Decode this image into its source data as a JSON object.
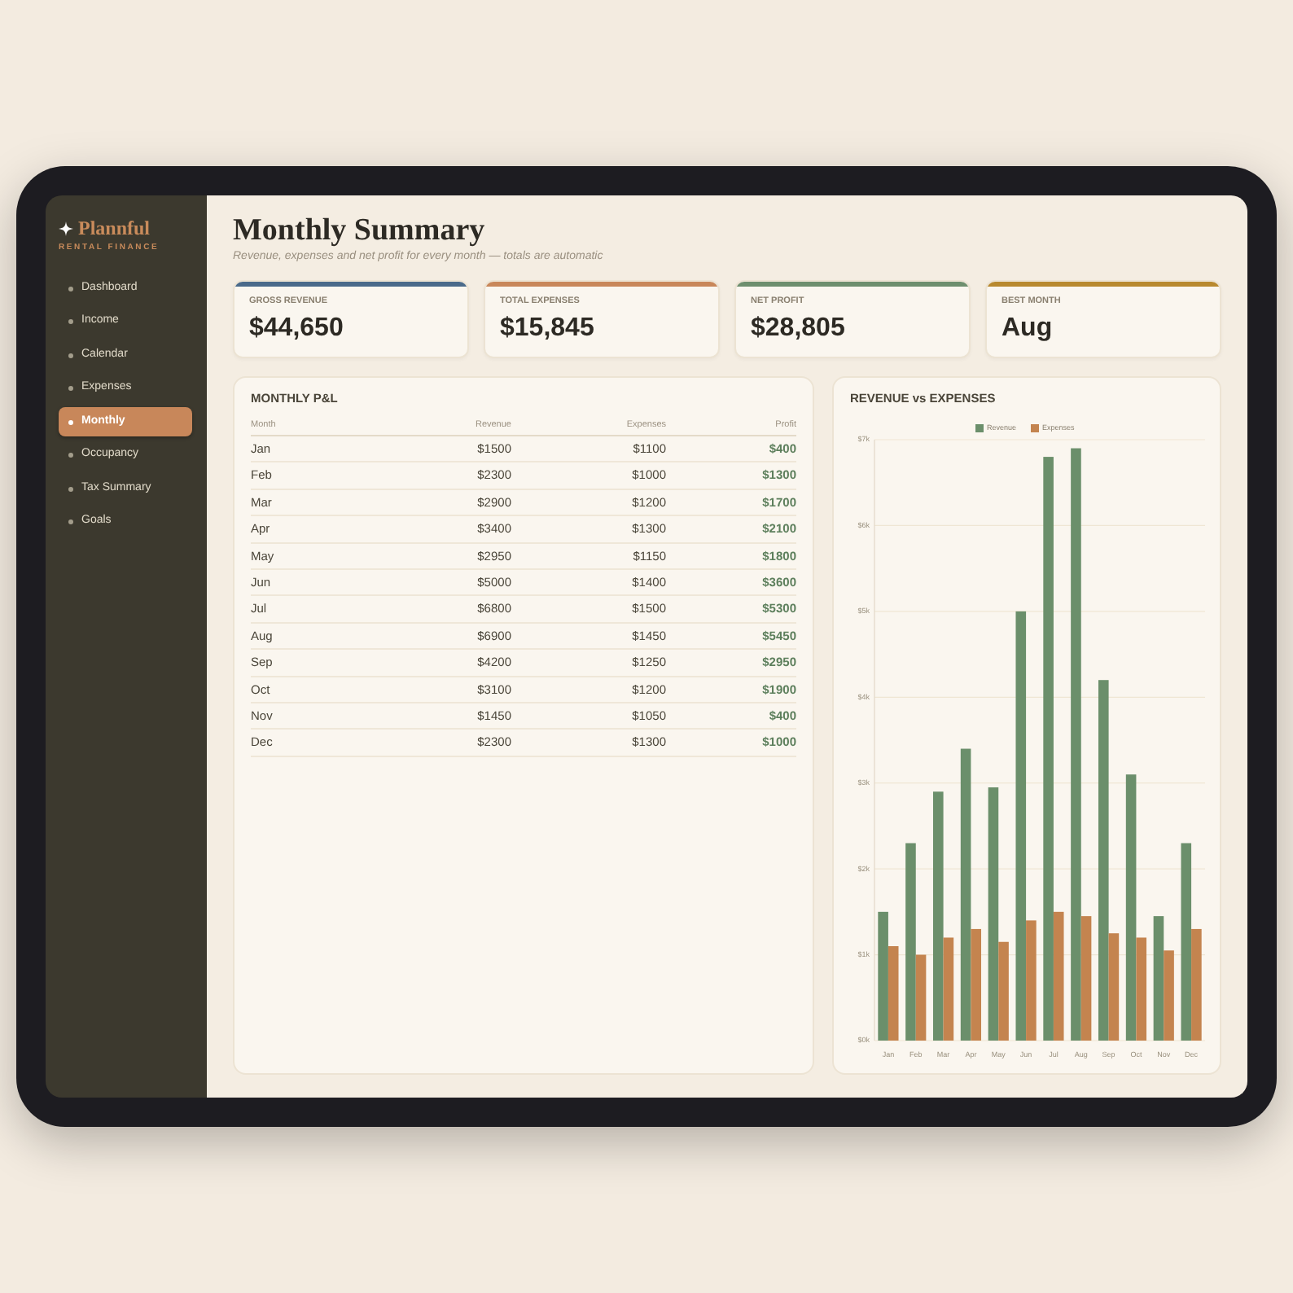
{
  "sidebar": {
    "logo": {
      "name": "Plannful",
      "tagline": "RENTAL FINANCE"
    },
    "items": [
      {
        "label": "Dashboard",
        "selected": false
      },
      {
        "label": "Income",
        "selected": false
      },
      {
        "label": "Calendar",
        "selected": false
      },
      {
        "label": "Expenses",
        "selected": false
      },
      {
        "label": "Monthly",
        "selected": true
      },
      {
        "label": "Occupancy",
        "selected": false
      },
      {
        "label": "Tax Summary",
        "selected": false
      },
      {
        "label": "Goals",
        "selected": false
      }
    ]
  },
  "header": {
    "title": "Monthly Summary",
    "subtitle": "Revenue, expenses and net profit for every month — totals are automatic"
  },
  "stat_cards": [
    {
      "label": "GROSS REVENUE",
      "value": "$44,650",
      "color": "#4a6a8a"
    },
    {
      "label": "TOTAL EXPENSES",
      "value": "$15,845",
      "color": "#c8875a"
    },
    {
      "label": "NET PROFIT",
      "value": "$28,805",
      "color": "#6e8f6e"
    },
    {
      "label": "BEST MONTH",
      "value": "Aug",
      "color": "#b8892f"
    }
  ],
  "pnl_table": {
    "title": "MONTHLY P&L",
    "columns": [
      "Month",
      "Revenue",
      "Expenses",
      "Profit"
    ],
    "rows": [
      [
        "Jan",
        "$1500",
        "$1100",
        "$400"
      ],
      [
        "Feb",
        "$2300",
        "$1000",
        "$1300"
      ],
      [
        "Mar",
        "$2900",
        "$1200",
        "$1700"
      ],
      [
        "Apr",
        "$3400",
        "$1300",
        "$2100"
      ],
      [
        "May",
        "$2950",
        "$1150",
        "$1800"
      ],
      [
        "Jun",
        "$5000",
        "$1400",
        "$3600"
      ],
      [
        "Jul",
        "$6800",
        "$1500",
        "$5300"
      ],
      [
        "Aug",
        "$6900",
        "$1450",
        "$5450"
      ],
      [
        "Sep",
        "$4200",
        "$1250",
        "$2950"
      ],
      [
        "Oct",
        "$3100",
        "$1200",
        "$1900"
      ],
      [
        "Nov",
        "$1450",
        "$1050",
        "$400"
      ],
      [
        "Dec",
        "$2300",
        "$1300",
        "$1000"
      ]
    ]
  },
  "chart": {
    "title": "REVENUE vs EXPENSES",
    "chart_data": {
      "type": "bar",
      "categories": [
        "Jan",
        "Feb",
        "Mar",
        "Apr",
        "May",
        "Jun",
        "Jul",
        "Aug",
        "Sep",
        "Oct",
        "Nov",
        "Dec"
      ],
      "series": [
        {
          "name": "Revenue",
          "color": "#6b8f6b",
          "values": [
            1500,
            2300,
            2900,
            3400,
            2950,
            5000,
            6800,
            6900,
            4200,
            3100,
            1450,
            2300
          ]
        },
        {
          "name": "Expenses",
          "color": "#c4844f",
          "values": [
            1100,
            1000,
            1200,
            1300,
            1150,
            1400,
            1500,
            1450,
            1250,
            1200,
            1050,
            1300
          ]
        }
      ],
      "ylim": [
        0,
        7000
      ],
      "yticks": [
        {
          "value": 0,
          "label": "$0k"
        },
        {
          "value": 1000,
          "label": "$1k"
        },
        {
          "value": 2000,
          "label": "$2k"
        },
        {
          "value": 3000,
          "label": "$3k"
        },
        {
          "value": 4000,
          "label": "$4k"
        },
        {
          "value": 5000,
          "label": "$5k"
        },
        {
          "value": 6000,
          "label": "$6k"
        },
        {
          "value": 7000,
          "label": "$7k"
        }
      ],
      "grid": true,
      "legend": true
    }
  }
}
